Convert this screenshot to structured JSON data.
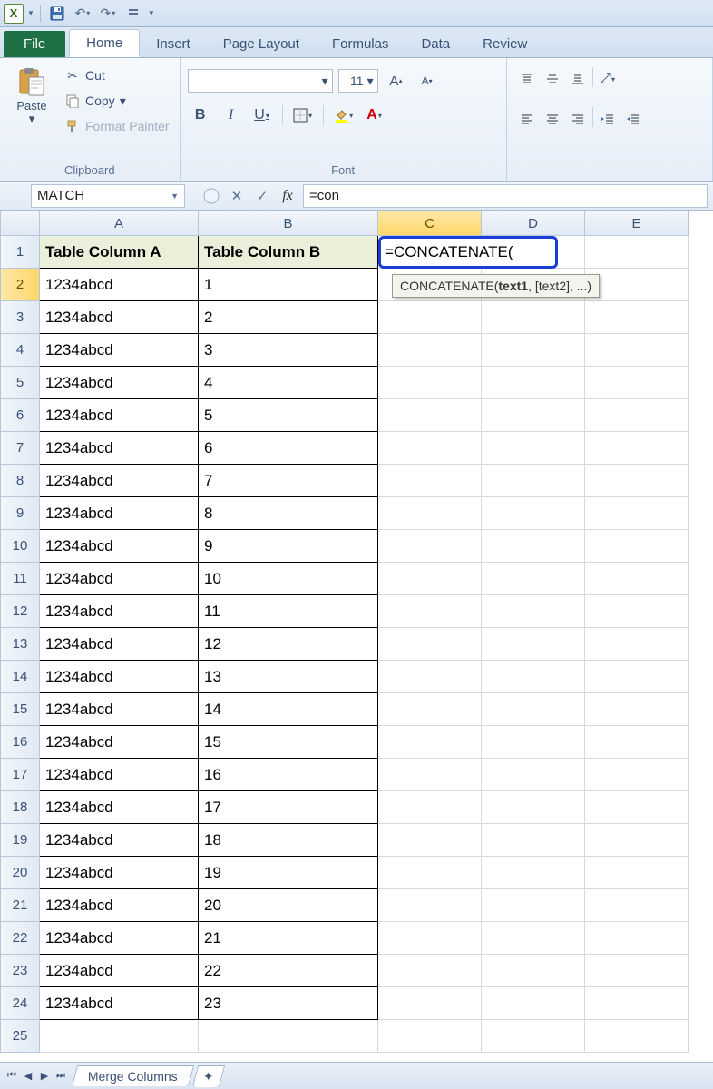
{
  "qat": {
    "app": "X"
  },
  "tabs": {
    "file": "File",
    "home": "Home",
    "insert": "Insert",
    "page_layout": "Page Layout",
    "formulas": "Formulas",
    "data": "Data",
    "review": "Review"
  },
  "ribbon": {
    "clipboard": {
      "label": "Clipboard",
      "paste": "Paste",
      "cut": "Cut",
      "copy": "Copy",
      "format_painter": "Format Painter"
    },
    "font": {
      "label": "Font",
      "font_name": "",
      "font_size": "11",
      "bold": "B",
      "italic": "I",
      "underline": "U"
    }
  },
  "formula_bar": {
    "name_box": "MATCH",
    "fx": "fx",
    "formula": "=con",
    "cancel": "✕",
    "enter": "✓"
  },
  "grid": {
    "columns": [
      "A",
      "B",
      "C",
      "D",
      "E"
    ],
    "active_col": "C",
    "active_row": 2,
    "headers": {
      "A": "Table Column A",
      "B": "Table Column B"
    },
    "editing_value": "=CONCATENATE(",
    "tooltip_fn": "CONCATENATE",
    "tooltip_args": "(text1, [text2], ...)",
    "rows": [
      {
        "n": 1,
        "A": "Table Column A",
        "B": "Table Column B",
        "hdr": true
      },
      {
        "n": 2,
        "A": "1234abcd",
        "B": "1"
      },
      {
        "n": 3,
        "A": "1234abcd",
        "B": "2"
      },
      {
        "n": 4,
        "A": "1234abcd",
        "B": "3"
      },
      {
        "n": 5,
        "A": "1234abcd",
        "B": "4"
      },
      {
        "n": 6,
        "A": "1234abcd",
        "B": "5"
      },
      {
        "n": 7,
        "A": "1234abcd",
        "B": "6"
      },
      {
        "n": 8,
        "A": "1234abcd",
        "B": "7"
      },
      {
        "n": 9,
        "A": "1234abcd",
        "B": "8"
      },
      {
        "n": 10,
        "A": "1234abcd",
        "B": "9"
      },
      {
        "n": 11,
        "A": "1234abcd",
        "B": "10"
      },
      {
        "n": 12,
        "A": "1234abcd",
        "B": "11"
      },
      {
        "n": 13,
        "A": "1234abcd",
        "B": "12"
      },
      {
        "n": 14,
        "A": "1234abcd",
        "B": "13"
      },
      {
        "n": 15,
        "A": "1234abcd",
        "B": "14"
      },
      {
        "n": 16,
        "A": "1234abcd",
        "B": "15"
      },
      {
        "n": 17,
        "A": "1234abcd",
        "B": "16"
      },
      {
        "n": 18,
        "A": "1234abcd",
        "B": "17"
      },
      {
        "n": 19,
        "A": "1234abcd",
        "B": "18"
      },
      {
        "n": 20,
        "A": "1234abcd",
        "B": "19"
      },
      {
        "n": 21,
        "A": "1234abcd",
        "B": "20"
      },
      {
        "n": 22,
        "A": "1234abcd",
        "B": "21"
      },
      {
        "n": 23,
        "A": "1234abcd",
        "B": "22"
      },
      {
        "n": 24,
        "A": "1234abcd",
        "B": "23"
      },
      {
        "n": 25,
        "A": "",
        "B": ""
      }
    ]
  },
  "sheet_tabs": {
    "active": "Merge Columns"
  }
}
